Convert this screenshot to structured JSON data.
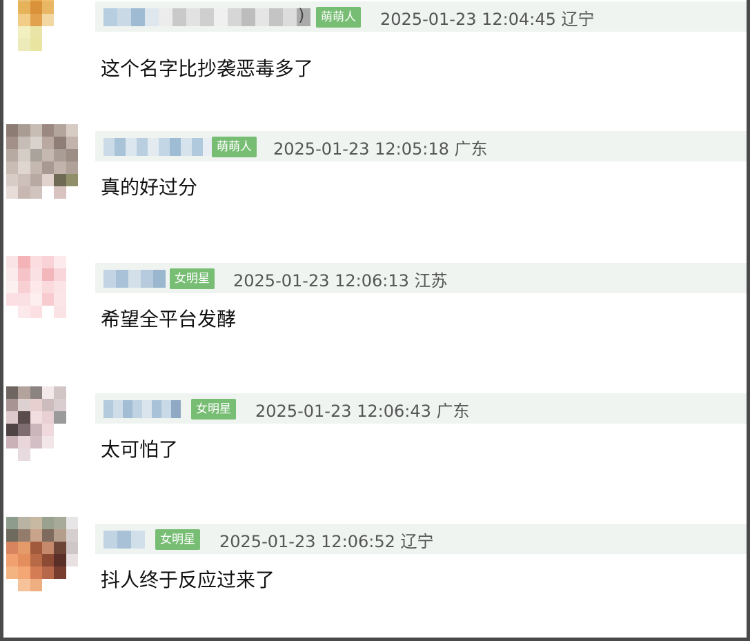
{
  "comments": [
    {
      "badge": "萌萌人",
      "timestamp": "2025-01-23 12:04:45",
      "location": "辽宁",
      "name_suffix": ")",
      "text": "这个名字比抄袭恶毒多了",
      "avatar_colors": [
        "#ffffff",
        "#e9c27a",
        "#e8a94f",
        "#f0c070",
        "#ffffff",
        "#ffffff",
        "#ffffff",
        "#e7b35a",
        "#d9913a",
        "#e9b764",
        "#ffffff",
        "#ffffff",
        "#ffffff",
        "#f1cd88",
        "#e2a24d",
        "#f3d7a3",
        "#ffffff",
        "#ffffff",
        "#ffffff",
        "#f2efc0",
        "#eae4a6",
        "#ffffff",
        "#ffffff",
        "#ffffff",
        "#ffffff",
        "#eceab8",
        "#e9e4a0",
        "#ffffff",
        "#ffffff",
        "#ffffff",
        "#ffffff",
        "#ffffff",
        "#ffffff",
        "#ffffff",
        "#ffffff",
        "#ffffff"
      ],
      "name_colors": [
        "#b7cde0",
        "#cad9e6",
        "#9fbad3",
        "#dfe7ee",
        "#ececec",
        "#c9c9c9",
        "#e2e2e2",
        "#cfcfcf",
        "#f0f0f0",
        "#d6d6d6",
        "#bdbdbd",
        "#e5e5e5",
        "#c4c4c4",
        "#dcdcdc",
        "#aaaaaa"
      ]
    },
    {
      "badge": "萌萌人",
      "timestamp": "2025-01-23 12:05:18",
      "location": "广东",
      "name_suffix": "",
      "text": "真的好过分",
      "avatar_colors": [
        "#8d7c74",
        "#a99c93",
        "#c8bdb4",
        "#9b8880",
        "#b3a59c",
        "#d7ccc4",
        "#a39189",
        "#c6bdb7",
        "#d9d2cc",
        "#b9a9a1",
        "#8f7d77",
        "#c2b4ad",
        "#b7aaa3",
        "#d5ccc5",
        "#a9a39c",
        "#c4b8b0",
        "#aa9d95",
        "#9c8e85",
        "#c9bcb5",
        "#e0d6d0",
        "#c5b8b1",
        "#a89a92",
        "#c2b4ac",
        "#b0a299",
        "#d8ccc6",
        "#cdbfb9",
        "#b8aaa3",
        "#e1d2cd",
        "#6f6a54",
        "#8f8f6a",
        "#e8dcd8",
        "#c9b7b2",
        "#d1c3bd",
        "#ffffff",
        "#d8c3c0",
        "#ffffff"
      ],
      "name_colors": [
        "#cbdbe8",
        "#a8c2d8",
        "#dce6ee",
        "#b9cfe0",
        "#e3ebf1",
        "#c2d6e5",
        "#9fbcd5",
        "#d6e2ec",
        "#b1c9dc",
        "#e8eef3"
      ]
    },
    {
      "badge": "女明星",
      "timestamp": "2025-01-23 12:06:13",
      "location": "江苏",
      "name_suffix": "",
      "text": "希望全平台发酵",
      "avatar_colors": [
        "#fbe4e6",
        "#f4b3b7",
        "#fbdcdf",
        "#f8d2d6",
        "#fdeaec",
        "#ffffff",
        "#fcebed",
        "#f6c4c8",
        "#fae1e4",
        "#f2b6bb",
        "#f9d6d9",
        "#ffffff",
        "#fdf0f1",
        "#f8cfd3",
        "#fde8ea",
        "#fbdadd",
        "#fce4e6",
        "#ffffff",
        "#fcdfe2",
        "#fae0e3",
        "#fdeef0",
        "#f7cbcf",
        "#fbe5e7",
        "#ffffff",
        "#ffffff",
        "#fde9eb",
        "#fcdfe2",
        "#ffffff",
        "#fbe2e5",
        "#ffffff",
        "#ffffff",
        "#ffffff",
        "#ffffff",
        "#ffffff",
        "#ffffff",
        "#ffffff"
      ],
      "name_colors": [
        "#c3d5e4",
        "#a9c2d7",
        "#d3e0ea",
        "#b6cbdd",
        "#9bb7d0"
      ]
    },
    {
      "badge": "女明星",
      "timestamp": "2025-01-23 12:06:43",
      "location": "广东",
      "name_suffix": "",
      "text": "太可怕了",
      "avatar_colors": [
        "#6f6662",
        "#b4a39d",
        "#8b8380",
        "#f3e8ea",
        "#d2c5c6",
        "#ffffff",
        "#a89493",
        "#ded1d2",
        "#e7cfd0",
        "#cdbcbe",
        "#d9cdd0",
        "#ffffff",
        "#ddc9cc",
        "#5a4b4c",
        "#f2dde0",
        "#e8d0d4",
        "#9a9a9a",
        "#ffffff",
        "#4f4344",
        "#7d6d70",
        "#cbb7bb",
        "#efd9dc",
        "#ffffff",
        "#ffffff",
        "#c9b1b7",
        "#e9d6da",
        "#d2bec4",
        "#f3e6e9",
        "#ffffff",
        "#ffffff",
        "#ffffff",
        "#e8dbe0",
        "#ffffff",
        "#ffffff",
        "#ffffff",
        "#ffffff"
      ],
      "name_colors": [
        "#b4cadd",
        "#cfdde9",
        "#a2bdd4",
        "#c0d3e3",
        "#d9e4ed",
        "#a9c2d8",
        "#c8d9e7",
        "#8fa9c4"
      ]
    },
    {
      "badge": "女明星",
      "timestamp": "2025-01-23 12:06:52",
      "location": "辽宁",
      "name_suffix": "",
      "text": "抖人终于反应过来了",
      "avatar_colors": [
        "#8d9c8c",
        "#b8b3a2",
        "#c7b9a2",
        "#9aa28f",
        "#a7aa99",
        "#e8e5e6",
        "#6f6a5e",
        "#947c6d",
        "#c9a48a",
        "#7f6b5e",
        "#b59d8b",
        "#d7cfcf",
        "#d8845e",
        "#e59a6a",
        "#a25a3d",
        "#c6896b",
        "#6c4536",
        "#cfc6c8",
        "#f0a16f",
        "#e58e5d",
        "#b86a47",
        "#8d4a34",
        "#5a2f27",
        "#e9e0e2",
        "#f3b482",
        "#f4a774",
        "#d47c53",
        "#b8684a",
        "#793d30",
        "#ffffff",
        "#ffffff",
        "#f5c29a",
        "#efae80",
        "#ffffff",
        "#ffffff",
        "#ffffff"
      ],
      "name_colors": [
        "#c1d4e3",
        "#a8c1d6",
        "#d1dfea"
      ]
    }
  ]
}
